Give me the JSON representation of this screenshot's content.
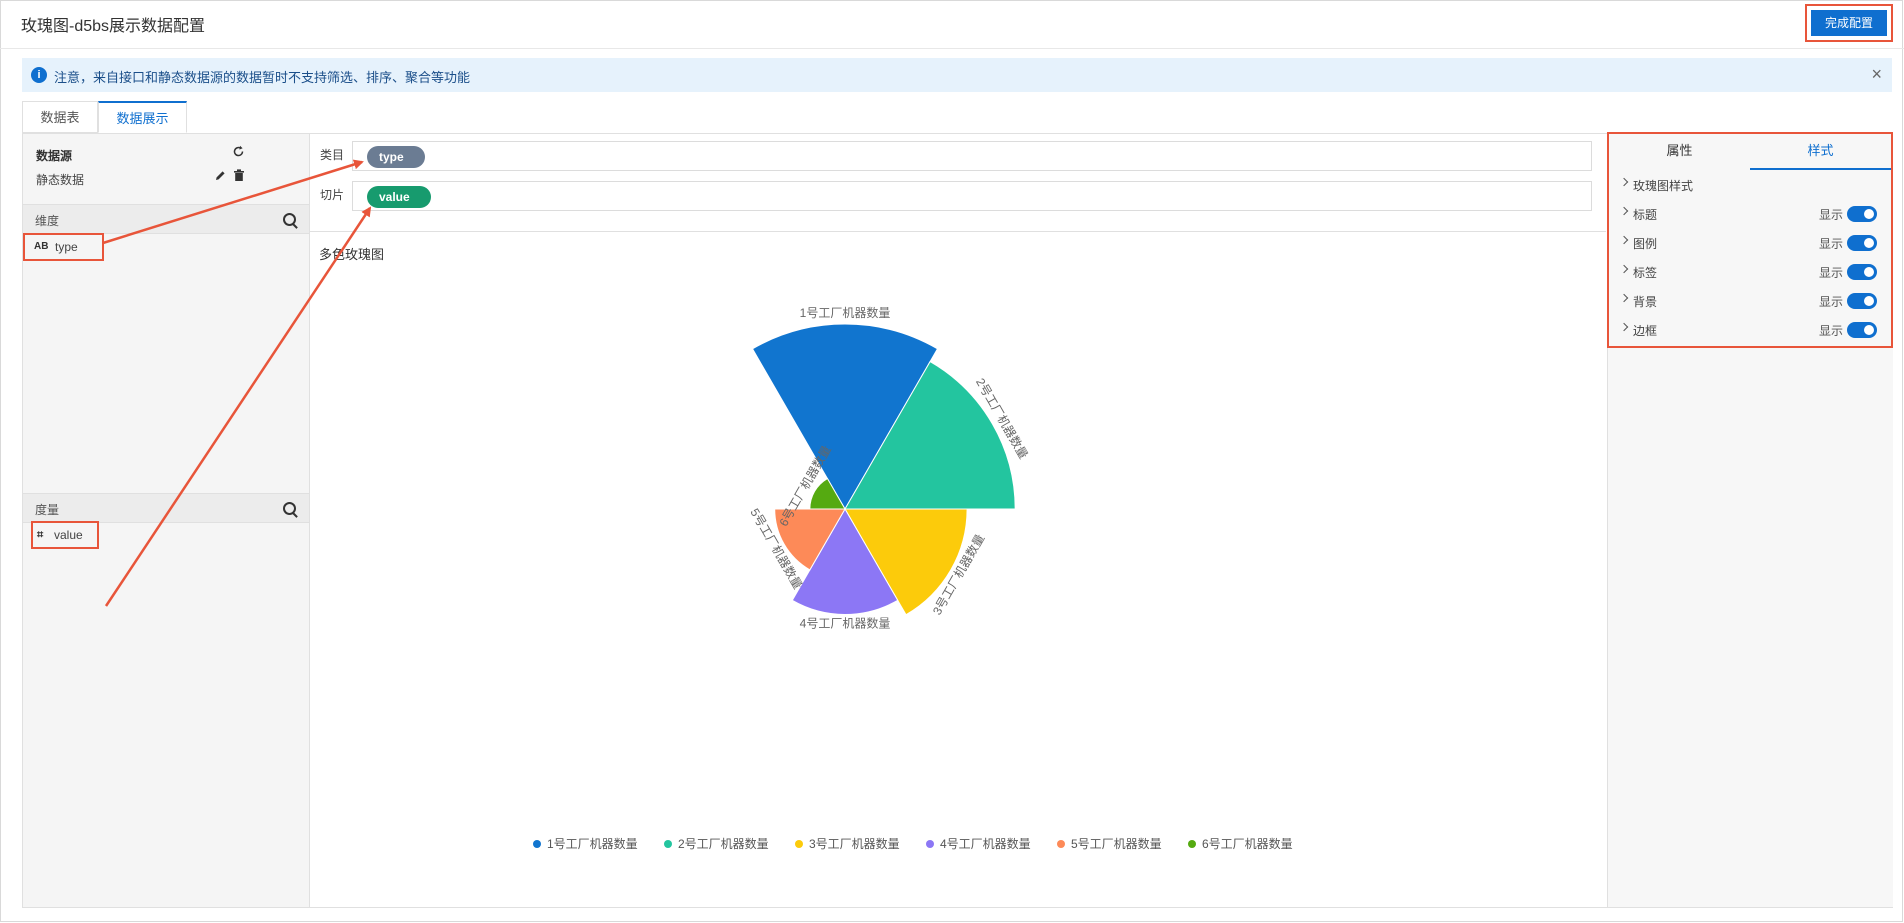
{
  "window": {
    "title": "玫瑰图-d5bs展示数据配置",
    "done_label": "完成配置"
  },
  "notice": {
    "text": "注意，来自接口和静态数据源的数据暂时不支持筛选、排序、聚合等功能",
    "info_icon": "i",
    "close_icon": "×"
  },
  "tabs": [
    {
      "label": "数据表"
    },
    {
      "label": "数据展示"
    }
  ],
  "left": {
    "datasource_header": "数据源",
    "datasource_name": "静态数据",
    "dimension_header": "维度",
    "dimension_fields": [
      {
        "type_icon": "AB",
        "name": "type"
      }
    ],
    "measure_header": "度量",
    "measure_fields": [
      {
        "type_icon": "⌗",
        "name": "value"
      }
    ]
  },
  "config": {
    "category_label": "类目",
    "category_value": "type",
    "slice_label": "切片",
    "slice_value": "value",
    "category_color": "#6b7c93",
    "slice_color": "#179b6e"
  },
  "chart_data": {
    "type": "pie",
    "subtype": "rose",
    "title": "多色玫瑰图",
    "categories": [
      "1号工厂机器数量",
      "2号工厂机器数量",
      "3号工厂机器数量",
      "4号工厂机器数量",
      "5号工厂机器数量",
      "6号工厂机器数量"
    ],
    "values": [
      100,
      92,
      66,
      57,
      38,
      19
    ],
    "colors": [
      "#1175cf",
      "#23c59f",
      "#fccb0b",
      "#8c77f5",
      "#fd8a58",
      "#55aa11"
    ],
    "legend_position": "bottom",
    "grid": false
  },
  "style_panel": {
    "tab_properties": "属性",
    "tab_style": "样式",
    "items": [
      {
        "label": "玫瑰图样式"
      },
      {
        "label": "标题",
        "switch_label": "显示",
        "on": true
      },
      {
        "label": "图例",
        "switch_label": "显示",
        "on": true
      },
      {
        "label": "标签",
        "switch_label": "显示",
        "on": true
      },
      {
        "label": "背景",
        "switch_label": "显示",
        "on": true
      },
      {
        "label": "边框",
        "switch_label": "显示",
        "on": true
      }
    ]
  },
  "annotations": {
    "highlight_color": "#e8553a"
  }
}
